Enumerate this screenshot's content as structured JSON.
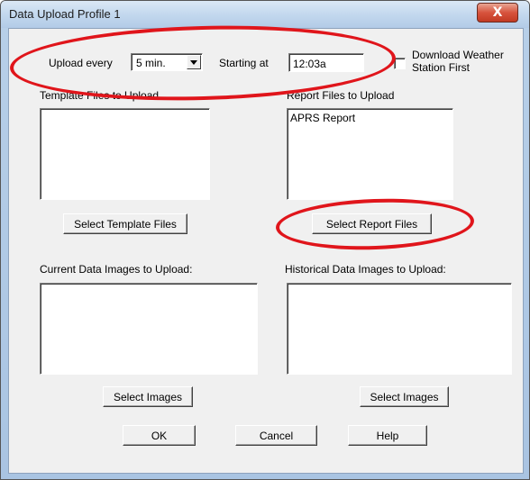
{
  "window": {
    "title": "Data Upload Profile 1",
    "close_glyph": "X"
  },
  "schedule": {
    "upload_every_label": "Upload every",
    "interval_value": "5 min.",
    "starting_at_label": "Starting at",
    "start_time": "12:03a",
    "download_weather_label_line1": "Download Weather",
    "download_weather_label_line2": "Station First",
    "download_weather_checked": false
  },
  "template_files": {
    "label": "Template Files to Upload",
    "items": [],
    "button": "Select Template Files"
  },
  "report_files": {
    "label": "Report Files to Upload",
    "items": [
      "APRS Report"
    ],
    "button": "Select Report Files"
  },
  "current_images": {
    "label": "Current Data Images to Upload:",
    "items": [],
    "button": "Select Images"
  },
  "historical_images": {
    "label": "Historical Data Images to Upload:",
    "items": [],
    "button": "Select Images"
  },
  "footer": {
    "ok": "OK",
    "cancel": "Cancel",
    "help": "Help"
  },
  "colors": {
    "highlight_ring": "#e0151b",
    "close_button": "#d7533d"
  }
}
